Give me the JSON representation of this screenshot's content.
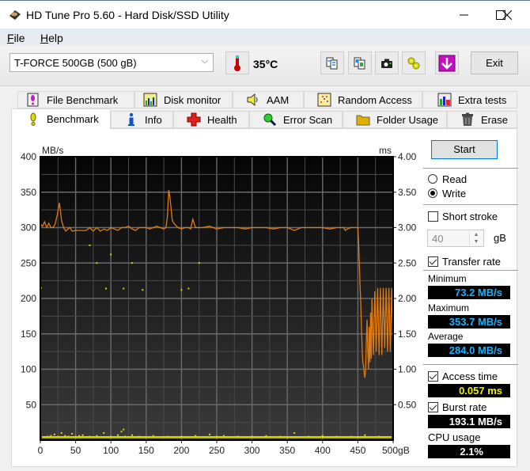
{
  "window": {
    "title": "HD Tune Pro 5.60 - Hard Disk/SSD Utility",
    "controls": [
      "minimize",
      "maximize",
      "close"
    ]
  },
  "menu": {
    "items": [
      {
        "label": "File",
        "accel": "F",
        "rest": "ile"
      },
      {
        "label": "Help",
        "accel": "H",
        "rest": "elp"
      }
    ]
  },
  "toolbar": {
    "drive": "T-FORCE 500GB (500 gB)",
    "temperature": "35°C",
    "icons": [
      "copy-text-icon",
      "copy-screenshot-icon",
      "camera-icon",
      "options-icon",
      "save-down-icon"
    ],
    "exit_label": "Exit"
  },
  "tabs": {
    "row1": [
      {
        "label": "File Benchmark",
        "icon": "file-benchmark-icon"
      },
      {
        "label": "Disk monitor",
        "icon": "disk-monitor-icon"
      },
      {
        "label": "AAM",
        "icon": "speaker-icon"
      },
      {
        "label": "Random Access",
        "icon": "random-access-icon"
      },
      {
        "label": "Extra tests",
        "icon": "extra-tests-icon"
      }
    ],
    "row2": [
      {
        "label": "Benchmark",
        "icon": "exclamation-icon",
        "active": true
      },
      {
        "label": "Info",
        "icon": "info-icon"
      },
      {
        "label": "Health",
        "icon": "health-cross-icon"
      },
      {
        "label": "Error Scan",
        "icon": "magnifier-icon"
      },
      {
        "label": "Folder Usage",
        "icon": "folder-icon"
      },
      {
        "label": "Erase",
        "icon": "trash-icon"
      }
    ]
  },
  "side": {
    "start_label": "Start",
    "read_label": "Read",
    "write_label": "Write",
    "mode": "Write",
    "short_stroke_label": "Short stroke",
    "short_stroke_checked": false,
    "short_stroke_value": "40",
    "short_stroke_unit": "gB",
    "transfer_rate_label": "Transfer rate",
    "transfer_rate_checked": true,
    "minimum_label": "Minimum",
    "minimum_value": "73.2 MB/s",
    "maximum_label": "Maximum",
    "maximum_value": "353.7 MB/s",
    "average_label": "Average",
    "average_value": "284.0 MB/s",
    "access_time_label": "Access time",
    "access_time_checked": true,
    "access_time_value": "0.057 ms",
    "burst_rate_label": "Burst rate",
    "burst_rate_checked": true,
    "burst_rate_value": "193.1 MB/s",
    "cpu_label": "CPU usage",
    "cpu_value": "2.1%"
  },
  "chart_data": {
    "type": "line",
    "title": "",
    "ylabel_left": "MB/s",
    "ylabel_right": "ms",
    "xlabel": "gB",
    "xlim": [
      0,
      500
    ],
    "ylim_left": [
      0,
      400
    ],
    "ylim_right": [
      0,
      4.0
    ],
    "x_ticks": [
      "0",
      "50",
      "100",
      "150",
      "200",
      "250",
      "300",
      "350",
      "400",
      "450",
      "500gB"
    ],
    "y_ticks_left": [
      "400",
      "350",
      "300",
      "250",
      "200",
      "150",
      "100",
      "50"
    ],
    "y_ticks_right": [
      "4.00",
      "3.50",
      "3.00",
      "2.50",
      "2.00",
      "1.50",
      "1.00",
      "0.50"
    ],
    "grid": true,
    "colors": {
      "transfer": "#e07a10",
      "access": "#d8d800",
      "grid": "#5a5a5a"
    },
    "series": [
      {
        "name": "Transfer rate (MB/s)",
        "x": [
          0,
          3,
          6,
          9,
          12,
          15,
          18,
          21,
          24,
          27,
          30,
          33,
          36,
          39,
          42,
          45,
          50,
          55,
          60,
          65,
          70,
          75,
          80,
          85,
          90,
          95,
          100,
          105,
          110,
          115,
          120,
          125,
          130,
          135,
          140,
          145,
          150,
          155,
          160,
          165,
          170,
          175,
          178,
          180,
          182,
          184,
          187,
          190,
          195,
          200,
          205,
          210,
          213,
          216,
          220,
          225,
          230,
          240,
          250,
          260,
          270,
          280,
          290,
          300,
          310,
          320,
          330,
          340,
          350,
          360,
          370,
          380,
          390,
          400,
          410,
          420,
          430,
          432,
          435,
          440,
          445,
          450,
          451,
          452,
          453,
          454,
          455,
          456,
          457,
          458,
          459,
          460,
          461,
          462,
          463,
          464,
          465,
          466,
          467,
          468,
          469,
          470,
          472,
          474,
          476,
          478,
          480,
          482,
          484,
          486,
          488,
          490,
          492,
          494,
          496,
          498,
          500
        ],
        "y": [
          305,
          302,
          308,
          300,
          306,
          300,
          300,
          305,
          318,
          335,
          310,
          300,
          295,
          298,
          300,
          295,
          296,
          296,
          296,
          296,
          300,
          295,
          300,
          295,
          298,
          296,
          300,
          298,
          296,
          300,
          300,
          302,
          298,
          296,
          300,
          300,
          300,
          298,
          300,
          302,
          300,
          298,
          300,
          315,
          353,
          340,
          310,
          305,
          300,
          298,
          300,
          300,
          298,
          312,
          300,
          300,
          300,
          302,
          298,
          300,
          300,
          300,
          298,
          300,
          300,
          300,
          298,
          300,
          300,
          296,
          300,
          300,
          300,
          300,
          298,
          300,
          300,
          296,
          298,
          300,
          300,
          300,
          280,
          250,
          220,
          195,
          160,
          130,
          110,
          105,
          95,
          88,
          100,
          140,
          170,
          130,
          100,
          160,
          110,
          180,
          115,
          200,
          120,
          210,
          125,
          215,
          120,
          215,
          120,
          215,
          130,
          215,
          125,
          215,
          125,
          215,
          120
        ]
      },
      {
        "name": "Access time (ms)",
        "x": [
          5,
          10,
          15,
          20,
          25,
          30,
          35,
          40,
          45,
          50,
          55,
          60,
          70,
          80,
          90,
          100,
          110,
          115,
          118,
          120,
          130,
          140,
          160,
          180,
          200,
          220,
          240,
          250,
          260,
          280,
          300,
          320,
          340,
          360,
          380,
          400,
          420,
          440,
          460,
          480,
          500
        ],
        "y": [
          0.04,
          0.05,
          0.06,
          0.08,
          0.05,
          0.1,
          0.06,
          0.05,
          0.09,
          0.05,
          0.06,
          0.07,
          0.05,
          0.06,
          0.1,
          0.05,
          0.07,
          0.12,
          0.15,
          0.05,
          0.07,
          0.05,
          0.06,
          0.05,
          0.05,
          0.06,
          0.08,
          0.05,
          0.06,
          0.05,
          0.05,
          0.06,
          0.05,
          0.1,
          0.05,
          0.06,
          0.05,
          0.05,
          0.07,
          0.05,
          0.08
        ]
      },
      {
        "name": "Access time outliers (ms)",
        "x": [
          1,
          70,
          80,
          93,
          100,
          118,
          130,
          145,
          200,
          210,
          225
        ],
        "y": [
          2.15,
          2.75,
          2.5,
          2.14,
          2.62,
          2.14,
          2.5,
          2.12,
          2.12,
          2.14,
          2.5
        ]
      }
    ]
  }
}
